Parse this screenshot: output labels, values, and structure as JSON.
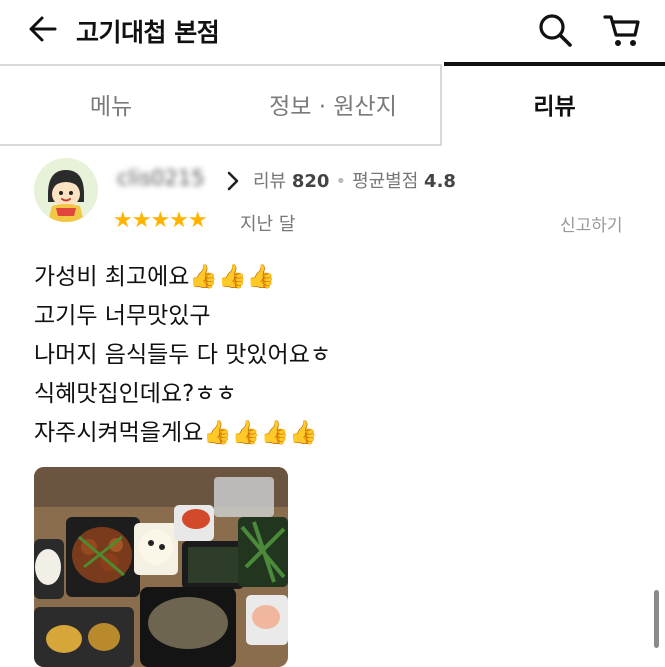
{
  "header": {
    "title": "고기대첩 본점",
    "back_icon": "arrow-left-icon",
    "search_icon": "search-icon",
    "cart_icon": "cart-icon"
  },
  "tabs": [
    {
      "label": "메뉴",
      "active": false
    },
    {
      "label": "정보 · 원산지",
      "active": false
    },
    {
      "label": "리뷰",
      "active": true
    }
  ],
  "review": {
    "nickname": "clis0215",
    "review_count_label": "리뷰",
    "review_count": "820",
    "avg_rating_label": "평균별점",
    "avg_rating": "4.8",
    "stars": "★★★★★",
    "rating": 5,
    "date": "지난 달",
    "report_label": "신고하기",
    "lines": [
      "가성비 최고에요👍👍👍",
      "고기두 너무맛있구",
      "나머지 음식들두 다 맛있어요ㅎ",
      "식혜맛집인데요?ㅎㅎ",
      "자주시켜먹을게요👍👍👍👍"
    ]
  },
  "colors": {
    "star": "#ffb400",
    "active_tab_underline": "#111111",
    "muted_text": "#777777"
  }
}
